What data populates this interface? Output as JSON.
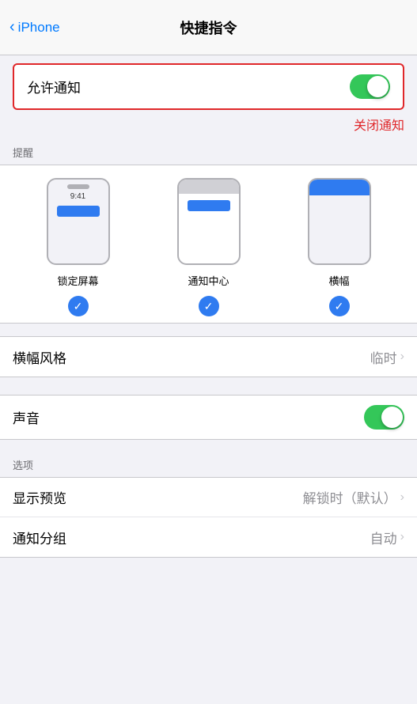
{
  "nav": {
    "back_label": "iPhone",
    "title": "快捷指令"
  },
  "allow_notifications": {
    "label": "允许通知",
    "toggle_state": "on",
    "close_btn": "关闭通知"
  },
  "reminders": {
    "section_label": "提醒",
    "styles": [
      {
        "id": "lockscreen",
        "label": "锁定屏幕",
        "checked": true
      },
      {
        "id": "notif-center",
        "label": "通知中心",
        "checked": true
      },
      {
        "id": "banner",
        "label": "横幅",
        "checked": true
      }
    ]
  },
  "banner_style": {
    "label": "横幅风格",
    "value": "临时",
    "has_chevron": true
  },
  "sound": {
    "label": "声音",
    "toggle_state": "on"
  },
  "options": {
    "section_label": "选项",
    "show_preview": {
      "label": "显示预览",
      "value": "解锁时（默认）",
      "has_chevron": true
    },
    "notif_group": {
      "label": "通知分组",
      "value": "自动",
      "has_chevron": true
    }
  },
  "icons": {
    "chevron_left": "‹",
    "chevron_right": "›",
    "checkmark": "✓"
  }
}
